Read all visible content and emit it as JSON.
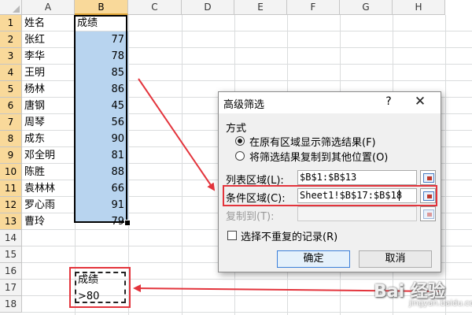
{
  "sheet": {
    "columns": [
      "A",
      "B",
      "C",
      "D",
      "E",
      "F",
      "G",
      "H"
    ],
    "rows": [
      "1",
      "2",
      "3",
      "4",
      "5",
      "6",
      "7",
      "8",
      "9",
      "10",
      "11",
      "12",
      "13",
      "14",
      "15",
      "16",
      "17",
      "18"
    ],
    "header": {
      "name": "姓名",
      "score": "成绩"
    },
    "records": [
      {
        "name": "张红",
        "score": "77"
      },
      {
        "name": "李华",
        "score": "78"
      },
      {
        "name": "王明",
        "score": "85"
      },
      {
        "name": "杨林",
        "score": "86"
      },
      {
        "name": "唐钢",
        "score": "45"
      },
      {
        "name": "周琴",
        "score": "56"
      },
      {
        "name": "成东",
        "score": "90"
      },
      {
        "name": "邓全明",
        "score": "81"
      },
      {
        "name": "陈胜",
        "score": "88"
      },
      {
        "name": "袁林林",
        "score": "66"
      },
      {
        "name": "罗心雨",
        "score": "91"
      },
      {
        "name": "曹玲",
        "score": "79"
      }
    ],
    "criteria": {
      "header": "成绩",
      "value": ">80"
    }
  },
  "dialog": {
    "title": "高级筛选",
    "help": "?",
    "close": "✕",
    "mode_group": "方式",
    "option_inplace": "在原有区域显示筛选结果(F)",
    "option_copy": "将筛选结果复制到其他位置(O)",
    "list_range_label": "列表区域(L):",
    "list_range_value": "$B$1:$B$13",
    "criteria_range_label": "条件区域(C):",
    "criteria_range_value": "Sheet1!$B$17:$B$18",
    "copy_to_label": "复制到(T):",
    "copy_to_value": "",
    "unique_label": "选择不重复的记录(R)",
    "ok": "确定",
    "cancel": "取消"
  },
  "watermark": {
    "main": "Bai 经验",
    "sub": "jingyan.baidu.com"
  },
  "colors": {
    "highlight": "#e3343c",
    "selection": "#b8d4ef",
    "header_selected": "#f9d99a"
  }
}
